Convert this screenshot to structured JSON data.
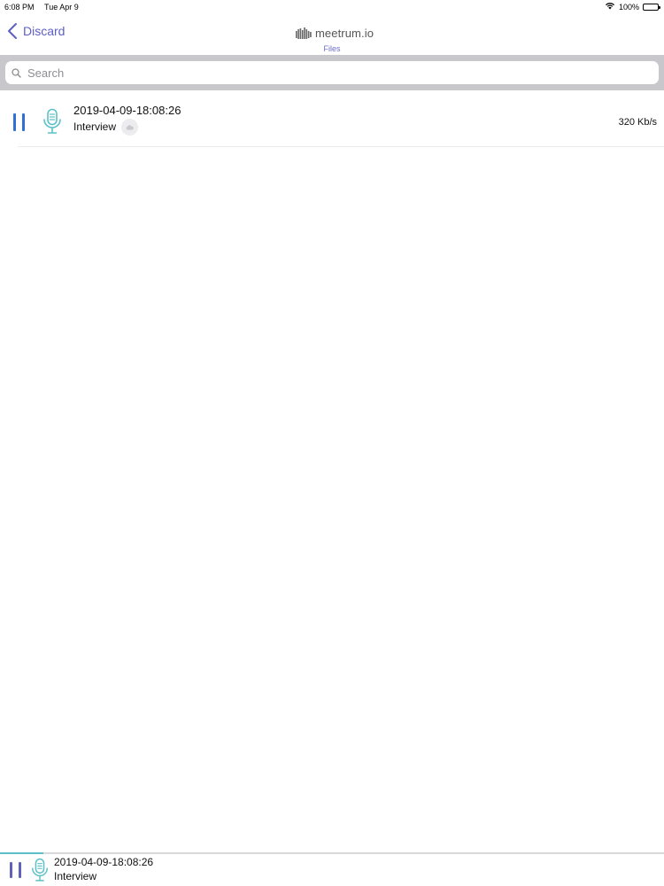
{
  "status_bar": {
    "time": "6:08 PM",
    "date": "Tue Apr 9",
    "battery": "100%",
    "battery_level": 1.0
  },
  "nav": {
    "back_label": "Discard",
    "brand": "meetrum.io",
    "subtitle": "Files"
  },
  "search": {
    "placeholder": "Search",
    "value": ""
  },
  "files": [
    {
      "title": "2019-04-09-18:08:26",
      "subtitle": "Interview",
      "bitrate": "320 Kb/s"
    }
  ],
  "player": {
    "title": "2019-04-09-18:08:26",
    "subtitle": "Interview",
    "progress": 0.065
  },
  "colors": {
    "accent": "#5d5fc4",
    "play_blue": "#2f6fd6",
    "mic_teal": "#5cc0c8",
    "search_bg": "#c8c8cc"
  },
  "icons": {
    "back": "chevron-left-icon",
    "brand": "waveform-logo-icon",
    "search": "search-icon",
    "pause": "pause-icon",
    "mic": "microphone-icon",
    "cloud": "cloud-icon",
    "wifi": "wifi-icon",
    "battery": "battery-icon"
  }
}
